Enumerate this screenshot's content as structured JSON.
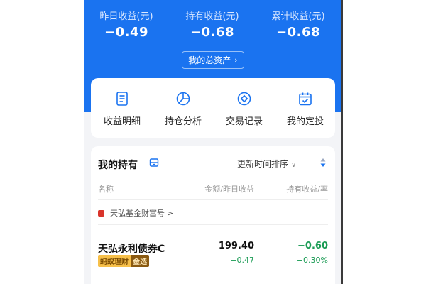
{
  "summary": {
    "yesterday": {
      "label": "昨日收益(元)",
      "value": "−0.49"
    },
    "holding": {
      "label": "持有收益(元)",
      "value": "−0.68"
    },
    "cumulative": {
      "label": "累计收益(元)",
      "value": "−0.68"
    },
    "total_assets_label": "我的总资产",
    "total_assets_chevron": "›"
  },
  "quick_actions": [
    {
      "label": "收益明细",
      "icon": "document-list-icon"
    },
    {
      "label": "持仓分析",
      "icon": "pie-chart-icon"
    },
    {
      "label": "交易记录",
      "icon": "circle-target-icon"
    },
    {
      "label": "我的定投",
      "icon": "calendar-check-icon"
    }
  ],
  "holdings": {
    "title": "我的持有",
    "sort_label": "更新时间排序",
    "sort_chevron": "∨",
    "columns": {
      "name": "名称",
      "amount": "金额/昨日收益",
      "profit": "持有收益/率"
    },
    "group": {
      "name": "天弘基金财富号",
      "chevron": ">"
    },
    "fund": {
      "name": "天弘永利债券C",
      "tag_main": "蚂蚁理财",
      "tag_sub": "金选",
      "amount": "199.40",
      "yesterday_profit": "−0.47",
      "holding_profit": "−0.60",
      "holding_rate": "−0.30%"
    }
  },
  "colors": {
    "brand_blue": "#1a73f0",
    "loss_green": "#1a9b54",
    "gold": "#f7c04a"
  }
}
